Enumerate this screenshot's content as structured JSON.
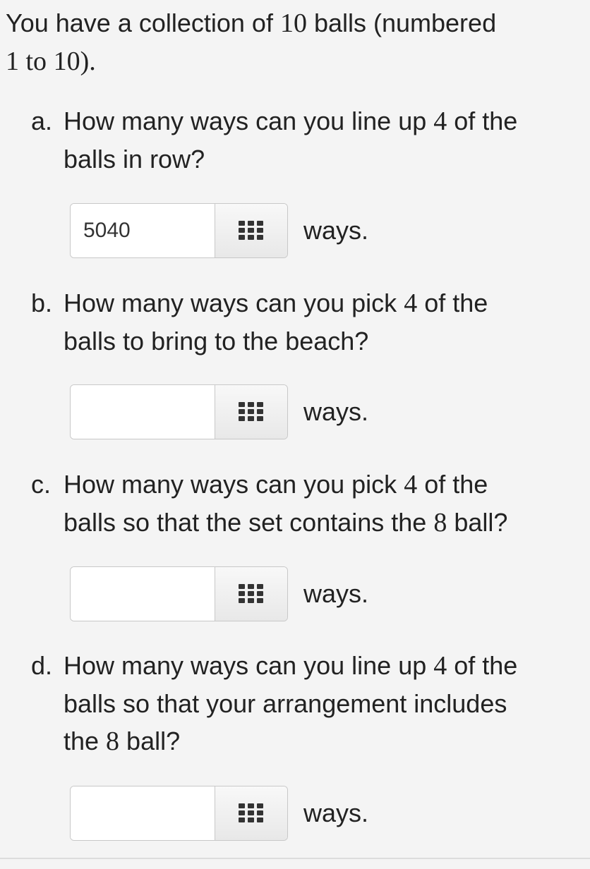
{
  "intro": {
    "pre": "You have a collection of ",
    "n": "10",
    "mid": " balls (numbered",
    "range_start": "1",
    "range_to": " to ",
    "range_end": "10",
    "post": ")."
  },
  "questions": [
    {
      "letter": "a.",
      "line1_pre": "How many ways can you line up ",
      "num": "4",
      "line1_post": " of the",
      "line2": "balls in row?",
      "input_value": "5040",
      "suffix": "ways."
    },
    {
      "letter": "b.",
      "line1_pre": "How many ways can you pick ",
      "num": "4",
      "line1_post": " of the",
      "line2": "balls to bring to the beach?",
      "input_value": "",
      "suffix": "ways."
    },
    {
      "letter": "c.",
      "line1_pre": "How many ways can you pick ",
      "num": "4",
      "line1_post": " of the",
      "line2_pre": "balls so that the set contains the ",
      "ball": "8",
      "line2_post": " ball?",
      "input_value": "",
      "suffix": "ways."
    },
    {
      "letter": "d.",
      "line1_pre": "How many ways can you line up ",
      "num": "4",
      "line1_post": " of the",
      "line2": "balls so that your arrangement includes",
      "line3_pre": "the ",
      "ball": "8",
      "line3_post": " ball?",
      "input_value": "",
      "suffix": "ways."
    }
  ],
  "icons": {
    "keyboard": "keypad-grid-icon"
  },
  "colors": {
    "background": "#f4f4f4",
    "text": "#222222",
    "border": "#c8c8c8",
    "icon": "#333333"
  }
}
